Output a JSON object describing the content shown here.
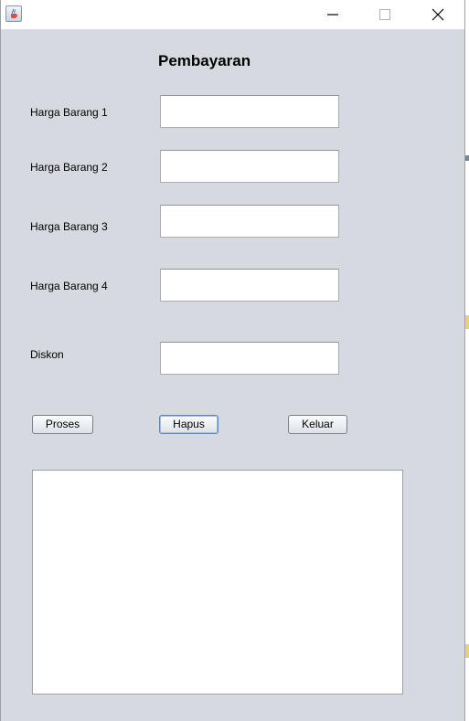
{
  "window": {
    "title": "",
    "controls": {
      "minimize": "minimize",
      "maximize": "maximize",
      "close": "close"
    }
  },
  "form": {
    "title": "Pembayaran",
    "fields": [
      {
        "label": "Harga Barang 1",
        "value": ""
      },
      {
        "label": "Harga Barang 2",
        "value": ""
      },
      {
        "label": "Harga Barang 3",
        "value": ""
      },
      {
        "label": "Harga Barang 4",
        "value": ""
      },
      {
        "label": "Diskon",
        "value": ""
      }
    ],
    "buttons": {
      "proses": "Proses",
      "hapus": "Hapus",
      "keluar": "Keluar"
    },
    "output": ""
  },
  "icons": {
    "app": "java-cup-icon",
    "minimize": "minimize-icon",
    "maximize": "maximize-icon",
    "close": "close-icon"
  },
  "colors": {
    "window_bg": "#d6d9df",
    "titlebar_bg": "#ffffff",
    "field_bg": "#ffffff"
  }
}
